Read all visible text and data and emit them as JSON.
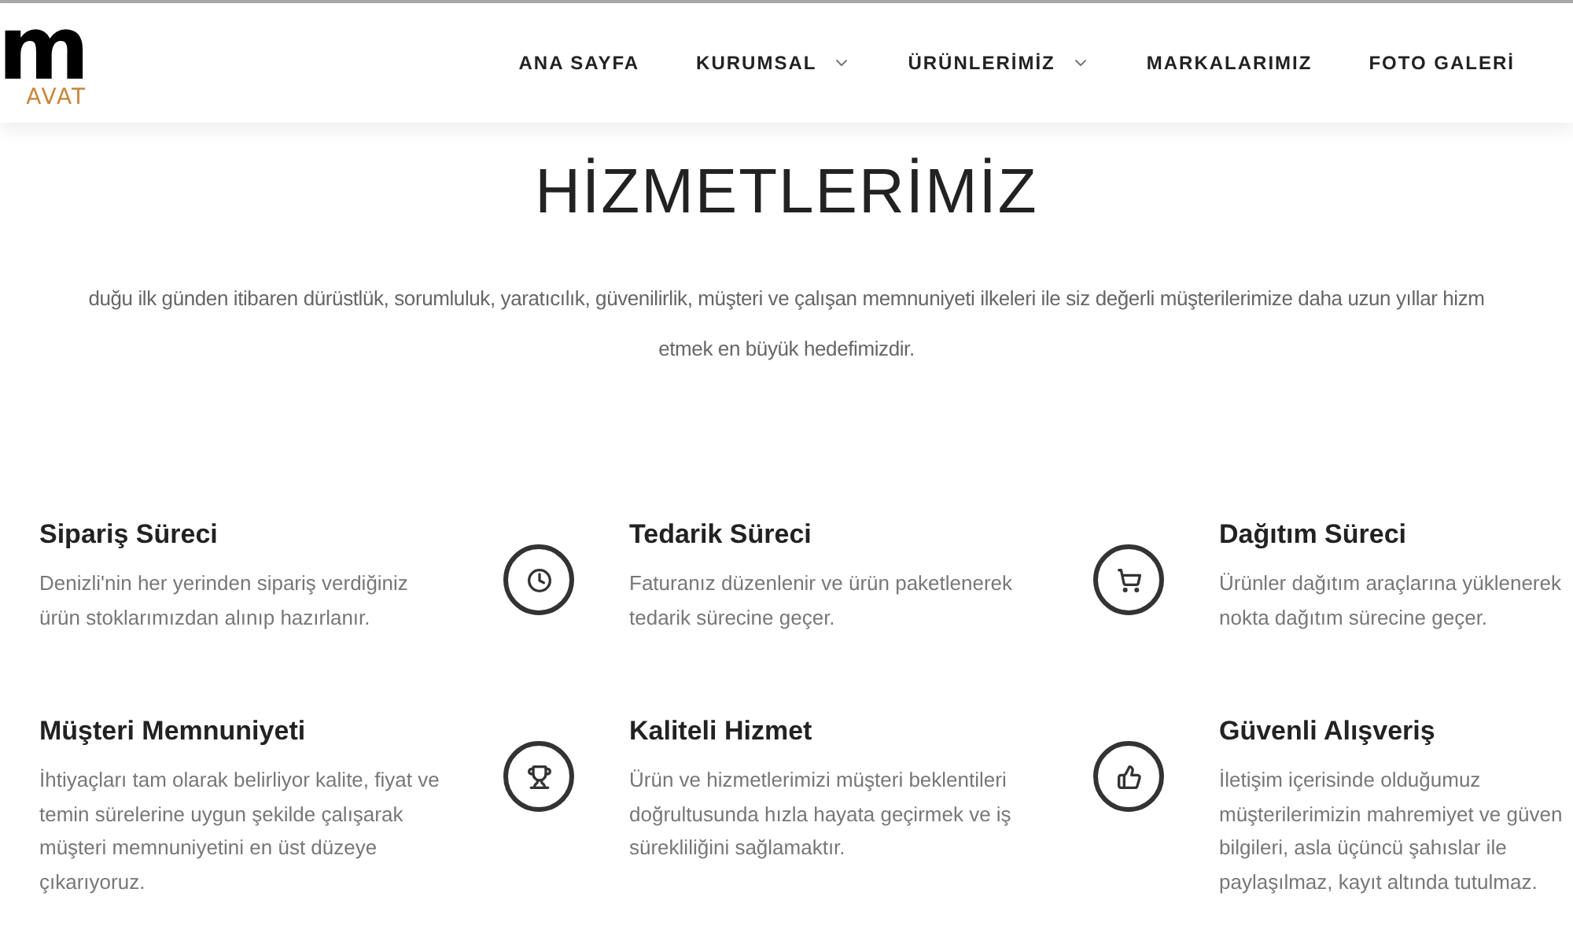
{
  "logo": {
    "mark": "m",
    "text": "AVAT"
  },
  "nav": [
    {
      "label": "ANA SAYFA",
      "dropdown": false
    },
    {
      "label": "KURUMSAL",
      "dropdown": true
    },
    {
      "label": "ÜRÜNLERİMİZ",
      "dropdown": true
    },
    {
      "label": "MARKALARIMIZ",
      "dropdown": false
    },
    {
      "label": "FOTO GALERİ",
      "dropdown": false
    }
  ],
  "section": {
    "title": "HİZMETLERİMİZ",
    "intro": [
      "duğu ilk günden itibaren dürüstlük, sorumluluk, yaratıcılık, güvenilirlik, müşteri ve çalışan memnuniyeti ilkeleri ile siz değerli müşterilerimize daha uzun yıllar hizm",
      "etmek en büyük hedefimizdir."
    ]
  },
  "services": [
    {
      "title": "Sipariş Süreci",
      "lines": [
        "Denizli'nin her yerinden sipariş verdiğiniz",
        "ürün stoklarımızdan alınıp hazırlanır."
      ]
    },
    {
      "kind": "clock",
      "title": "Tedarik Süreci",
      "lines": [
        "Faturanız düzenlenir ve ürün paketlenerek",
        "tedarik sürecine geçer."
      ]
    },
    {
      "kind": "cart",
      "title": "Dağıtım Süreci",
      "lines": [
        "Ürünler dağıtım araçlarına yüklenerek",
        "nokta dağıtım sürecine geçer."
      ]
    },
    {
      "title": "Müşteri Memnuniyeti",
      "lines": [
        "İhtiyaçları tam olarak belirliyor kalite, fiyat ve",
        "temin sürelerine uygun şekilde çalışarak",
        "müşteri memnuniyetini en üst düzeye",
        "çıkarıyoruz."
      ]
    },
    {
      "kind": "trophy",
      "title": "Kaliteli Hizmet",
      "lines": [
        "Ürün ve hizmetlerimizi müşteri beklentileri",
        "doğrultusunda hızla hayata geçirmek ve iş",
        "sürekliliğini sağlamaktır."
      ]
    },
    {
      "kind": "thumb",
      "title": "Güvenli Alışveriş",
      "lines": [
        "İletişim içerisinde olduğumuz",
        "müşterilerimizin mahremiyet ve güven",
        "bilgileri, asla üçüncü şahıslar ile",
        "paylaşılmaz, kayıt altında tutulmaz."
      ]
    }
  ]
}
